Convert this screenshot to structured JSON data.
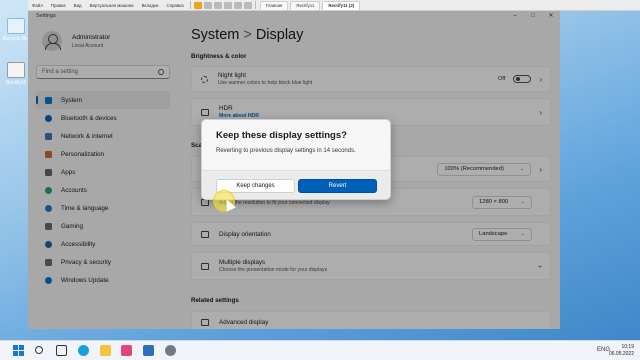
{
  "desktop": {
    "icons": [
      {
        "label": "Recycle Bin",
        "icon": "recycle-bin-icon"
      },
      {
        "label": "Rectify11",
        "icon": "shortcut-icon"
      }
    ]
  },
  "vm_toolbar": {
    "menus": [
      "Файл",
      "Правка",
      "Вид",
      "Виртуальная машина",
      "Вкладки",
      "Справка"
    ],
    "tabs": [
      {
        "label": "Главная",
        "active": false
      },
      {
        "label": "Rectify11",
        "active": false
      },
      {
        "label": "Rectify11 (2)",
        "active": true
      }
    ]
  },
  "window": {
    "title": "Settings",
    "controls": [
      "minimize-icon",
      "maximize-icon",
      "close-icon"
    ],
    "user": {
      "name": "Administrator",
      "type": "Local Account"
    },
    "search": {
      "placeholder": "Find a setting"
    },
    "nav": [
      {
        "label": "System",
        "active": true,
        "color": "#0078d4"
      },
      {
        "label": "Bluetooth & devices",
        "active": false,
        "color": "#0067c0"
      },
      {
        "label": "Network & internet",
        "active": false,
        "color": "#4a6fb5"
      },
      {
        "label": "Personalization",
        "active": false,
        "color": "#d06a2a"
      },
      {
        "label": "Apps",
        "active": false,
        "color": "#5b6b7a"
      },
      {
        "label": "Accounts",
        "active": false,
        "color": "#2a9d6f"
      },
      {
        "label": "Time & language",
        "active": false,
        "color": "#1b7fc4"
      },
      {
        "label": "Gaming",
        "active": false,
        "color": "#6b6b6b"
      },
      {
        "label": "Accessibility",
        "active": false,
        "color": "#2c5ea8"
      },
      {
        "label": "Privacy & security",
        "active": false,
        "color": "#6b6b6b"
      },
      {
        "label": "Windows Update",
        "active": false,
        "color": "#0078d4"
      }
    ],
    "breadcrumb": {
      "parent": "System",
      "separator": ">",
      "current": "Display"
    },
    "sections": {
      "brightness": "Brightness & color",
      "scale_partial": "Scal",
      "related": "Related settings"
    },
    "cards": {
      "night_light": {
        "title": "Night light",
        "subtitle": "Use warmer colors to help block blue light",
        "state": "Off"
      },
      "hdr": {
        "title": "HDR",
        "link": "More about HDR"
      },
      "scale": {
        "value": "100% (Recommended)"
      },
      "resolution": {
        "subtitle": "Adjust the resolution to fit your connected display",
        "value": "1280 × 800"
      },
      "orientation": {
        "title": "Display orientation",
        "value": "Landscape"
      },
      "multiple": {
        "title": "Multiple displays",
        "subtitle": "Choose the presentation mode for your displays"
      },
      "advanced_partial": "Advanced display"
    }
  },
  "dialog": {
    "title": "Keep these display settings?",
    "message": "Reverting to previous display settings in 14 seconds.",
    "keep_label": "Keep changes",
    "revert_label": "Revert",
    "accent": "#005fb8"
  },
  "taskbar": {
    "apps": [
      "start-icon",
      "search-icon",
      "task-view-icon",
      "edge-icon",
      "explorer-icon",
      "store-icon",
      "mail-icon",
      "settings-icon"
    ],
    "tray_lang": "ENG",
    "time": "10:19",
    "date": "06.05.2022"
  }
}
